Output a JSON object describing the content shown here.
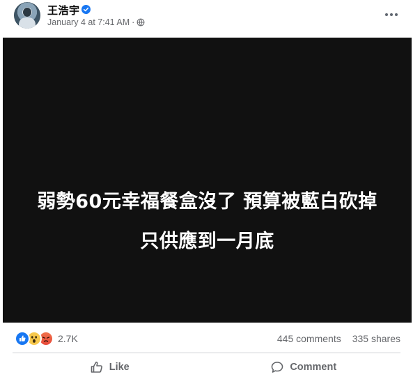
{
  "post": {
    "author": "王浩宇",
    "timestamp": "January 4 at 7:41 AM",
    "separator": "·",
    "audience_icon": "globe-icon",
    "verified_icon": "verified-badge-icon",
    "more_icon": "more-options-icon"
  },
  "media": {
    "background": "#111111",
    "line1": "弱勢60元幸福餐盒沒了 預算被藍白砍掉",
    "line2": "只供應到一月底"
  },
  "stats": {
    "reactions": [
      "like",
      "wow",
      "angry"
    ],
    "reaction_count": "2.7K",
    "comments": "445 comments",
    "shares": "335 shares"
  },
  "actions": {
    "like_label": "Like",
    "comment_label": "Comment"
  },
  "colors": {
    "accent": "#1877f2",
    "secondary_text": "#65676b",
    "primary_text": "#050505"
  }
}
